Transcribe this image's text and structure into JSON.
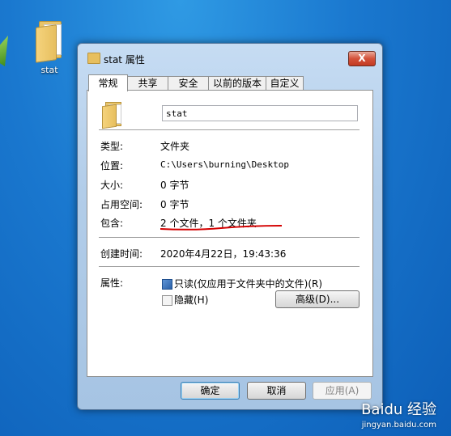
{
  "desktop": {
    "icon_label": "stat"
  },
  "dialog": {
    "title": "stat 属性",
    "close_label": "X",
    "tabs": [
      {
        "label": "常规",
        "active": true
      },
      {
        "label": "共享"
      },
      {
        "label": "安全"
      },
      {
        "label": "以前的版本"
      },
      {
        "label": "自定义"
      }
    ],
    "name_value": "stat",
    "rows": {
      "type": {
        "label": "类型:",
        "value": "文件夹"
      },
      "location": {
        "label": "位置:",
        "value": "C:\\Users\\burning\\Desktop"
      },
      "size": {
        "label": "大小:",
        "value": "0 字节"
      },
      "size_on_disk": {
        "label": "占用空间:",
        "value": "0 字节"
      },
      "contains": {
        "label": "包含:",
        "value": "2 个文件，1 个文件夹"
      },
      "created": {
        "label": "创建时间:",
        "value": "2020年4月22日，19:43:36"
      }
    },
    "attributes": {
      "label": "属性:",
      "readonly": {
        "label": "只读(仅应用于文件夹中的文件)(R)",
        "checked": true
      },
      "hidden": {
        "label": "隐藏(H)",
        "checked": false
      },
      "advanced_button": "高级(D)..."
    },
    "buttons": {
      "ok": "确定",
      "cancel": "取消",
      "apply": "应用(A)"
    }
  },
  "watermark": {
    "line1": "Baidu 经验",
    "line2": "jingyan.baidu.com"
  },
  "colors": {
    "annotation_line": "#d40000",
    "desktop": "#1a78cf"
  }
}
